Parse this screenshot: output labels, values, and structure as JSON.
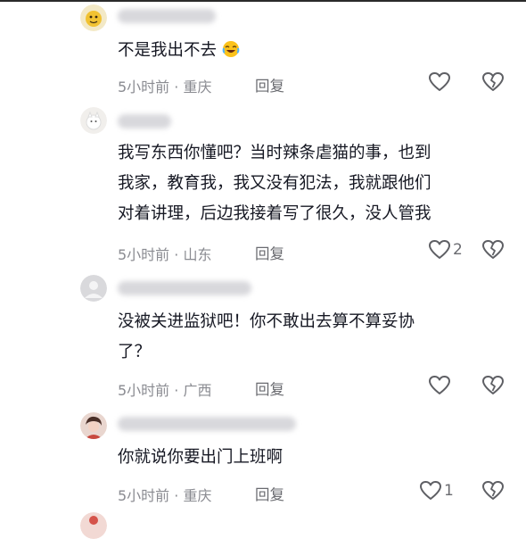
{
  "colors": {
    "text": "#161823",
    "meta": "#8a8b91",
    "icon": "#5e5f64"
  },
  "comments": [
    {
      "text": "不是我出不去",
      "emoji": "crying-laughing-emoji",
      "time": "5小时前",
      "location": "重庆",
      "reply_label": "回复",
      "likes": ""
    },
    {
      "text": "我写东西你懂吧？当时辣条虐猫的事，也到\n我家，教育我，我又没有犯法，我就跟他们\n对着讲理，后边我接着写了很久，没人管我",
      "time": "5小时前",
      "location": "山东",
      "reply_label": "回复",
      "likes": "2"
    },
    {
      "text": "没被关进监狱吧！你不敢出去算不算妥协\n了？",
      "time": "5小时前",
      "location": "广西",
      "reply_label": "回复",
      "likes": ""
    },
    {
      "text": "你就说你要出门上班啊",
      "time": "5小时前",
      "location": "重庆",
      "reply_label": "回复",
      "likes": "1"
    }
  ]
}
